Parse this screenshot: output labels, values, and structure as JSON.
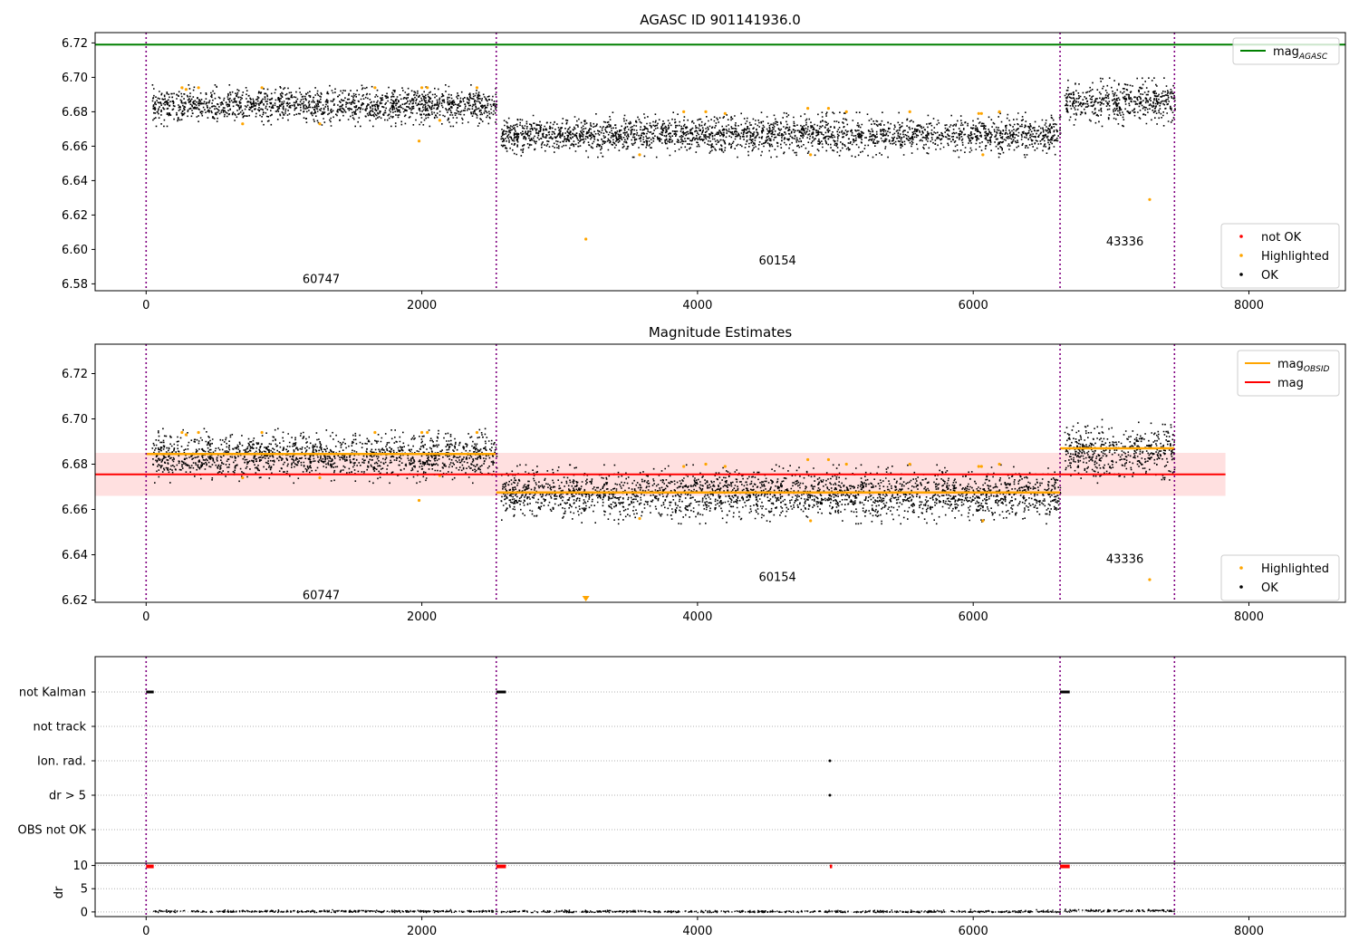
{
  "chart_data": [
    {
      "type": "scatter",
      "title": "AGASC ID 901141936.0",
      "xlim": [
        -370,
        8700
      ],
      "ylim": [
        6.576,
        6.726
      ],
      "xticks": [
        0,
        2000,
        4000,
        6000,
        8000
      ],
      "yticks": [
        6.58,
        6.6,
        6.62,
        6.64,
        6.66,
        6.68,
        6.7,
        6.72
      ],
      "vlines": [
        0,
        2540,
        6630,
        7460
      ],
      "hlines": [
        {
          "name": "mag_AGASC",
          "y": 6.719,
          "color": "#008000"
        }
      ],
      "segments": [
        {
          "obsid": "60747",
          "x_range": [
            40,
            2540
          ],
          "mean": 6.684,
          "spread": 0.012,
          "label_x": 1270,
          "label_y": 6.583
        },
        {
          "obsid": "60154",
          "x_range": [
            2570,
            6630
          ],
          "mean": 6.667,
          "spread": 0.013,
          "label_x": 4580,
          "label_y": 6.594
        },
        {
          "obsid": "43336",
          "x_range": [
            6660,
            7460
          ],
          "mean": 6.686,
          "spread": 0.014,
          "label_x": 7100,
          "label_y": 6.605
        }
      ],
      "highlighted_points": [
        [
          260,
          6.694
        ],
        [
          290,
          6.693
        ],
        [
          380,
          6.694
        ],
        [
          700,
          6.673
        ],
        [
          840,
          6.694
        ],
        [
          1260,
          6.673
        ],
        [
          1660,
          6.694
        ],
        [
          1980,
          6.663
        ],
        [
          2000,
          6.694
        ],
        [
          2040,
          6.694
        ],
        [
          2130,
          6.675
        ],
        [
          2400,
          6.694
        ],
        [
          3190,
          6.606
        ],
        [
          3580,
          6.655
        ],
        [
          3900,
          6.68
        ],
        [
          4060,
          6.68
        ],
        [
          4200,
          6.679
        ],
        [
          4800,
          6.682
        ],
        [
          4820,
          6.655
        ],
        [
          4950,
          6.682
        ],
        [
          5080,
          6.68
        ],
        [
          5540,
          6.68
        ],
        [
          6040,
          6.679
        ],
        [
          6060,
          6.679
        ],
        [
          6070,
          6.655
        ],
        [
          6190,
          6.68
        ],
        [
          7280,
          6.629
        ]
      ],
      "legend": {
        "placement": "top-right",
        "entries": [
          {
            "label": "mag",
            "subscript": "AGASC",
            "color": "#008000"
          }
        ]
      },
      "legend2": {
        "placement": "bottom-right",
        "entries": [
          {
            "label": "not OK",
            "color": "#ff0000"
          },
          {
            "label": "Highlighted",
            "color": "#ffa500"
          },
          {
            "label": "OK",
            "color": "#000000"
          }
        ]
      }
    },
    {
      "type": "scatter",
      "title": "Magnitude Estimates",
      "xlim": [
        -370,
        8700
      ],
      "ylim": [
        6.619,
        6.733
      ],
      "xticks": [
        0,
        2000,
        4000,
        6000,
        8000
      ],
      "yticks": [
        6.62,
        6.64,
        6.66,
        6.68,
        6.7,
        6.72
      ],
      "vlines": [
        0,
        2540,
        6630,
        7460
      ],
      "mag": {
        "value": 6.6755,
        "band": [
          6.666,
          6.685
        ],
        "x_range": [
          -370,
          7830
        ],
        "color": "#ff0000"
      },
      "obsid_mags": [
        {
          "x_range": [
            0,
            2540
          ],
          "y": 6.6845
        },
        {
          "x_range": [
            2540,
            6630
          ],
          "y": 6.6675
        },
        {
          "x_range": [
            6630,
            7460
          ],
          "y": 6.687
        }
      ],
      "segments": [
        {
          "obsid": "60747",
          "x_range": [
            40,
            2540
          ],
          "mean": 6.684,
          "spread": 0.012,
          "label_x": 1270,
          "label_y": 6.6225
        },
        {
          "obsid": "60154",
          "x_range": [
            2570,
            6630
          ],
          "mean": 6.667,
          "spread": 0.013,
          "label_x": 4580,
          "label_y": 6.6305
        },
        {
          "obsid": "43336",
          "x_range": [
            6660,
            7460
          ],
          "mean": 6.686,
          "spread": 0.014,
          "label_x": 7100,
          "label_y": 6.6385
        }
      ],
      "highlighted_points": [
        [
          260,
          6.694
        ],
        [
          290,
          6.693
        ],
        [
          380,
          6.694
        ],
        [
          700,
          6.674
        ],
        [
          840,
          6.694
        ],
        [
          1260,
          6.674
        ],
        [
          1660,
          6.694
        ],
        [
          1980,
          6.664
        ],
        [
          2000,
          6.694
        ],
        [
          2040,
          6.694
        ],
        [
          2130,
          6.675
        ],
        [
          2400,
          6.694
        ],
        [
          3580,
          6.656
        ],
        [
          3900,
          6.679
        ],
        [
          4060,
          6.68
        ],
        [
          4200,
          6.679
        ],
        [
          4800,
          6.682
        ],
        [
          4820,
          6.655
        ],
        [
          4950,
          6.682
        ],
        [
          5080,
          6.68
        ],
        [
          5540,
          6.68
        ],
        [
          6040,
          6.679
        ],
        [
          6060,
          6.679
        ],
        [
          6070,
          6.655
        ],
        [
          6190,
          6.68
        ],
        [
          7280,
          6.629
        ]
      ],
      "offscale_marker": {
        "x": 3190,
        "color": "#ffa500"
      },
      "legend": {
        "placement": "top-right",
        "entries": [
          {
            "label": "mag",
            "subscript": "OBSID",
            "color": "#ffa500"
          },
          {
            "label": "mag",
            "color": "#ff0000"
          }
        ]
      },
      "legend2": {
        "placement": "bottom-right",
        "entries": [
          {
            "label": "Highlighted",
            "color": "#ffa500"
          },
          {
            "label": "OK",
            "color": "#000000"
          }
        ]
      }
    },
    {
      "type": "scatter",
      "title": "",
      "xlim": [
        -370,
        8700
      ],
      "categories": [
        "not Kalman",
        "not track",
        "Ion. rad.",
        "dr > 5",
        "OBS not OK"
      ],
      "vlines": [
        0,
        2540,
        6630,
        7460
      ],
      "flags": [
        {
          "category": "not Kalman",
          "x_ranges": [
            [
              0,
              55
            ],
            [
              2540,
              2610
            ],
            [
              6630,
              6700
            ]
          ]
        },
        {
          "category": "Ion. rad.",
          "points": [
            4960
          ]
        },
        {
          "category": "dr > 5",
          "points": [
            4960
          ]
        }
      ]
    },
    {
      "type": "scatter",
      "title": "",
      "ylabel": "dr",
      "xlim": [
        -370,
        8700
      ],
      "ylim": [
        -1,
        10.5
      ],
      "xticks": [
        0,
        2000,
        4000,
        6000,
        8000
      ],
      "yticks": [
        0,
        5,
        10
      ],
      "vlines": [
        0,
        2540,
        6630,
        7460
      ],
      "dr_high": [
        {
          "x_range": [
            0,
            55
          ],
          "y": 9.8
        },
        {
          "x_range": [
            2540,
            2610
          ],
          "y": 9.8
        },
        {
          "x_range": [
            6630,
            6700
          ],
          "y": 9.8
        },
        {
          "x_range": [
            4960,
            4962
          ],
          "y": 9.8
        }
      ],
      "dr_low": [
        {
          "x_range": [
            40,
            2540
          ],
          "mean": 0.25
        },
        {
          "x_range": [
            2570,
            6630
          ],
          "mean": 0.2
        },
        {
          "x_range": [
            6660,
            7460
          ],
          "mean": 0.4
        }
      ]
    }
  ]
}
